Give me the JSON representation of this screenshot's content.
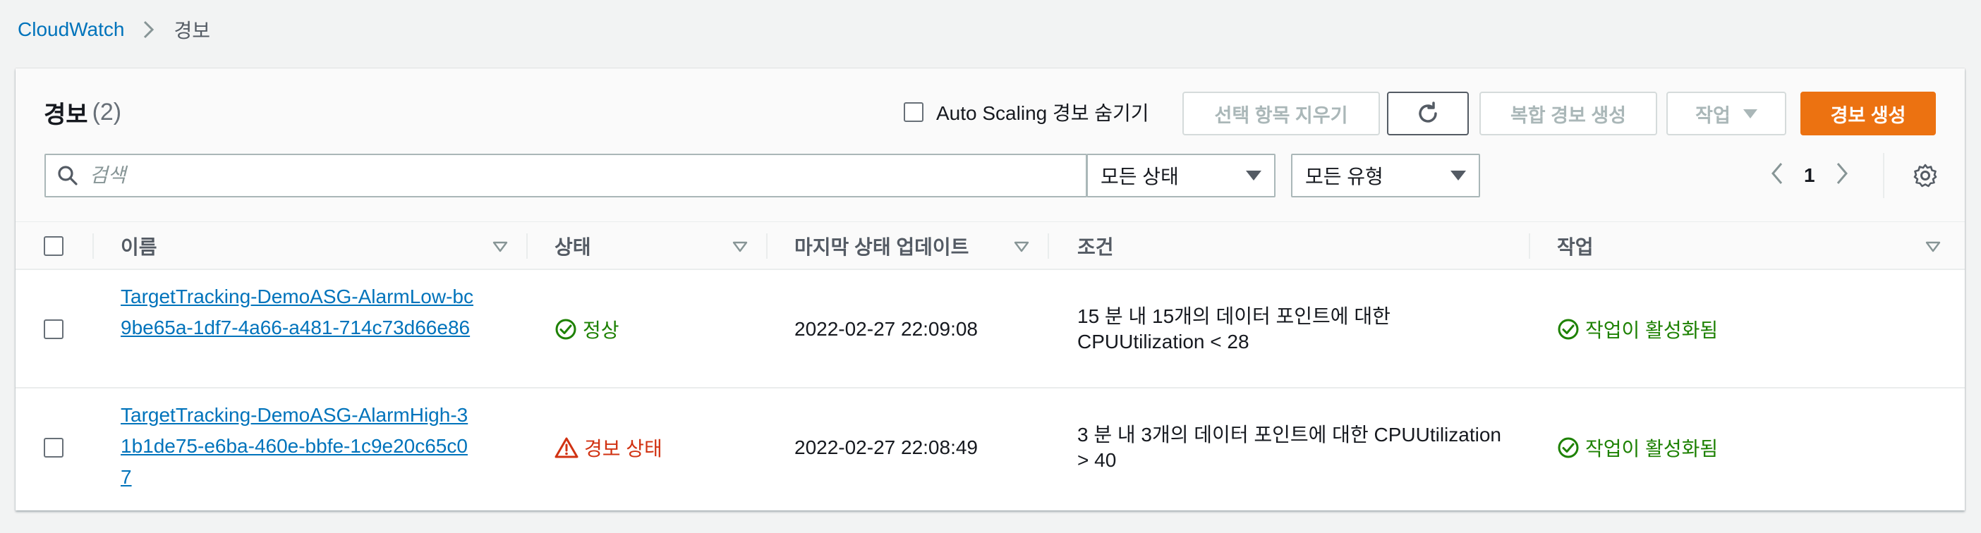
{
  "breadcrumb": {
    "root": "CloudWatch",
    "current": "경보"
  },
  "header": {
    "title": "경보",
    "count": "(2)",
    "hide_autoscaling_label": "Auto Scaling 경보 숨기기",
    "clear_selection_label": "선택 항목 지우기",
    "create_composite_label": "복합 경보 생성",
    "actions_label": "작업",
    "create_alarm_label": "경보 생성"
  },
  "filters": {
    "search_placeholder": "검색",
    "state_select": "모든 상태",
    "type_select": "모든 유형"
  },
  "pagination": {
    "current_page": "1"
  },
  "table": {
    "columns": [
      "이름",
      "상태",
      "마지막 상태 업데이트",
      "조건",
      "작업"
    ],
    "rows": [
      {
        "name": "TargetTracking-DemoASG-AlarmLow-bc9be65a-1df7-4a66-a481-714c73d66e86",
        "state": "정상",
        "last_update": "2022-02-27 22:09:08",
        "condition": "15 분 내 15개의 데이터 포인트에 대한 CPUUtilization < 28",
        "actions": "작업이 활성화됨"
      },
      {
        "name": "TargetTracking-DemoASG-AlarmHigh-31b1de75-e6ba-460e-bbfe-1c9e20c65c07",
        "state": "경보 상태",
        "last_update": "2022-02-27 22:08:49",
        "condition": "3 분 내 3개의 데이터 포인트에 대한 CPUUtilization > 40",
        "actions": "작업이 활성화됨"
      }
    ]
  },
  "colors": {
    "link": "#0073bb",
    "ok": "#1d8102",
    "alarm": "#d13212",
    "primary": "#ec7211"
  }
}
